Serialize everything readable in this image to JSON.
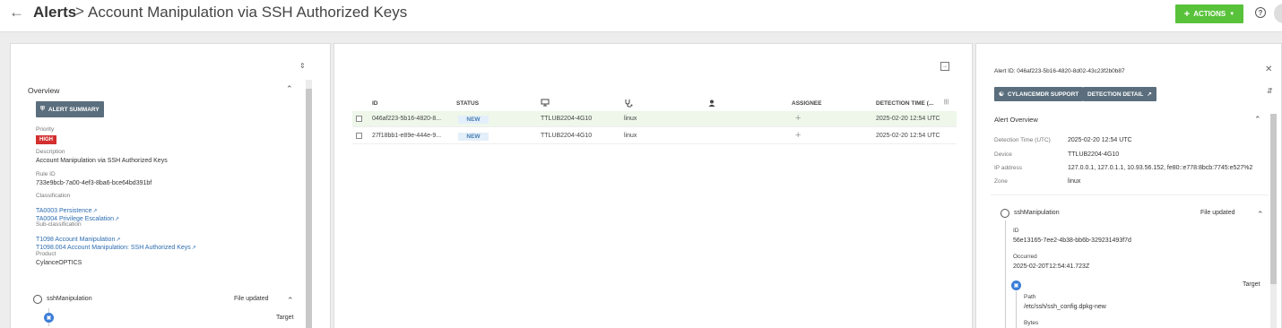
{
  "header": {
    "back_icon": "arrow-left-icon",
    "root": "Alerts",
    "separator": ">",
    "title": "Account Manipulation via SSH Authorized Keys",
    "actions_label": "ACTIONS",
    "actions_color": "#58c23a"
  },
  "left": {
    "section_title": "Overview",
    "summary_button": "ALERT SUMMARY",
    "priority_label": "Priority",
    "priority_value": "HIGH",
    "priority_color": "#d32f2f",
    "description_label": "Description",
    "description_value": "Account Manipulation via SSH Authorized Keys",
    "rule_id_label": "Rule ID",
    "rule_id_value": "733e9bcb-7a00-4ef3-8ba6-bce64bd391bf",
    "classification_label": "Classification",
    "classification_links": [
      "TA0003 Persistence",
      "TA0004 Privilege Escalation"
    ],
    "subclassification_label": "Sub-classification",
    "subclassification_links": [
      "T1098 Account Manipulation",
      "T1098.004 Account Manipulation: SSH Authorized Keys"
    ],
    "product_label": "Product",
    "product_value": "CylanceOPTICS",
    "event_name": "sshManipulation",
    "event_status": "File updated",
    "target_label": "Target"
  },
  "table": {
    "columns": [
      "ID",
      "STATUS",
      "",
      "",
      "",
      "ASSIGNEE",
      "DETECTION TIME (..."
    ],
    "column_icons": [
      "monitor-icon",
      "stethoscope-icon",
      "person-icon"
    ],
    "rows": [
      {
        "id": "046af223-5b16-4820-8...",
        "status": "NEW",
        "device": "TTLUB2204-4G10",
        "os": "linux",
        "assignee": "+",
        "time": "2025-02-20 12:54 UTC"
      },
      {
        "id": "27f18bb1-e89e-444e-9...",
        "status": "NEW",
        "device": "TTLUB2204-4G10",
        "os": "linux",
        "assignee": "+",
        "time": "2025-02-20 12:54 UTC"
      }
    ]
  },
  "right": {
    "alert_id": "Alert ID: 046af223-5b16-4820-8d02-43c23f2b0b87",
    "support_button": "CYLANCEMDR SUPPORT",
    "detail_button": "DETECTION DETAIL",
    "overview_title": "Alert Overview",
    "detection_time_label": "Detection Time (UTC)",
    "detection_time_value": "2025-02-20 12:54 UTC",
    "device_label": "Device",
    "device_value": "TTLUB2204-4G10",
    "ip_label": "IP address",
    "ip_value": "127.0.0.1, 127.0.1.1, 10.93.56.152, fe80::e778:8bcb:7745:e527%2",
    "zone_label": "Zone",
    "zone_value": "linux",
    "event_name": "sshManipulation",
    "event_status": "File updated",
    "id_label": "ID",
    "id_value": "56e13165-7ee2-4b38-bb6b-329231493f7d",
    "occurred_label": "Occurred",
    "occurred_value": "2025-02-20T12:54:41.723Z",
    "target_label": "Target",
    "path_label": "Path",
    "path_value": "/etc/ssh/ssh_config.dpkg-new",
    "bytes_label": "Bytes"
  }
}
